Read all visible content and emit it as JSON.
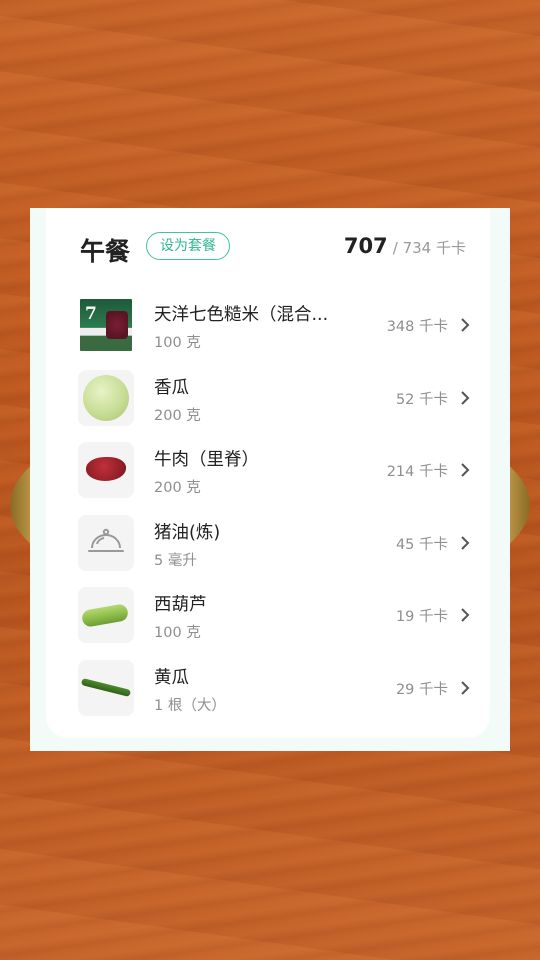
{
  "meal": {
    "title": "午餐",
    "set_button": "设为套餐",
    "calories_current": "707",
    "calories_target": "/ 734 千卡"
  },
  "items": [
    {
      "name": "天洋七色糙米（混合...",
      "qty": "100 克",
      "kcal": "348 千卡",
      "icon": "rice-package-photo"
    },
    {
      "name": "香瓜",
      "qty": "200 克",
      "kcal": "52 千卡",
      "icon": "melon-photo"
    },
    {
      "name": "牛肉（里脊）",
      "qty": "200 克",
      "kcal": "214 千卡",
      "icon": "beef-photo"
    },
    {
      "name": "猪油(炼)",
      "qty": "5 毫升",
      "kcal": "45 千卡",
      "icon": "cloche-icon"
    },
    {
      "name": "西葫芦",
      "qty": "100 克",
      "kcal": "19 千卡",
      "icon": "zucchini-photo"
    },
    {
      "name": "黄瓜",
      "qty": "1 根（大）",
      "kcal": "29 千卡",
      "icon": "cucumber-photo"
    }
  ],
  "colors": {
    "accent": "#3fc3a0",
    "text_primary": "#222222",
    "text_secondary": "#8f8f8f",
    "background_wood": "#c05a22"
  }
}
